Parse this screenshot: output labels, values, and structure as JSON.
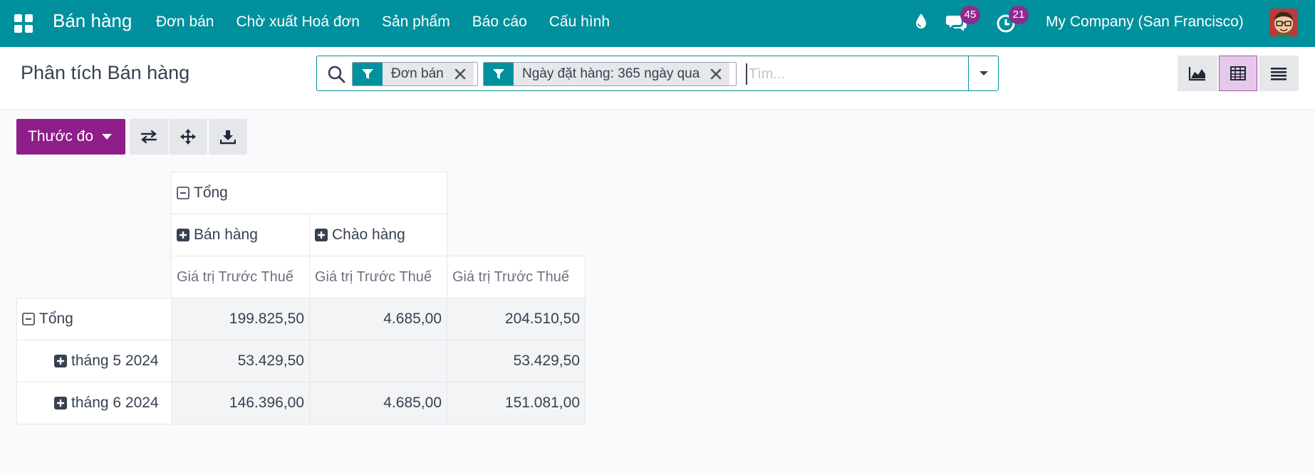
{
  "navbar": {
    "app_name": "Bán hàng",
    "menu": [
      "Đơn bán",
      "Chờ xuất Hoá đơn",
      "Sản phẩm",
      "Báo cáo",
      "Cấu hình"
    ],
    "chat_count": "45",
    "activity_count": "21",
    "company": "My Company (San Francisco)",
    "accent_color": "#01909d"
  },
  "control_panel": {
    "title": "Phân tích Bán hàng",
    "facets": [
      {
        "icon": "filter-icon",
        "label": "Đơn bán"
      },
      {
        "icon": "filter-icon",
        "label": "Ngày đặt hàng: 365 ngày qua"
      }
    ],
    "search_placeholder": "Tìm...",
    "views": [
      "graph",
      "pivot",
      "list"
    ],
    "active_view": "pivot"
  },
  "toolbar": {
    "measure_label": "Thước đo",
    "measure_color": "#8f1d8a"
  },
  "pivot": {
    "col_total": "Tổng",
    "col_groups": [
      "Bán hàng",
      "Chào hàng"
    ],
    "measure": "Giá trị Trước Thuế",
    "rows": [
      {
        "label": "Tổng",
        "expanded": true,
        "values": [
          "199.825,50",
          "4.685,00",
          "204.510,50"
        ]
      },
      {
        "label": "tháng 5 2024",
        "expanded": false,
        "values": [
          "53.429,50",
          "",
          "53.429,50"
        ]
      },
      {
        "label": "tháng 6 2024",
        "expanded": false,
        "values": [
          "146.396,00",
          "4.685,00",
          "151.081,00"
        ]
      }
    ]
  }
}
